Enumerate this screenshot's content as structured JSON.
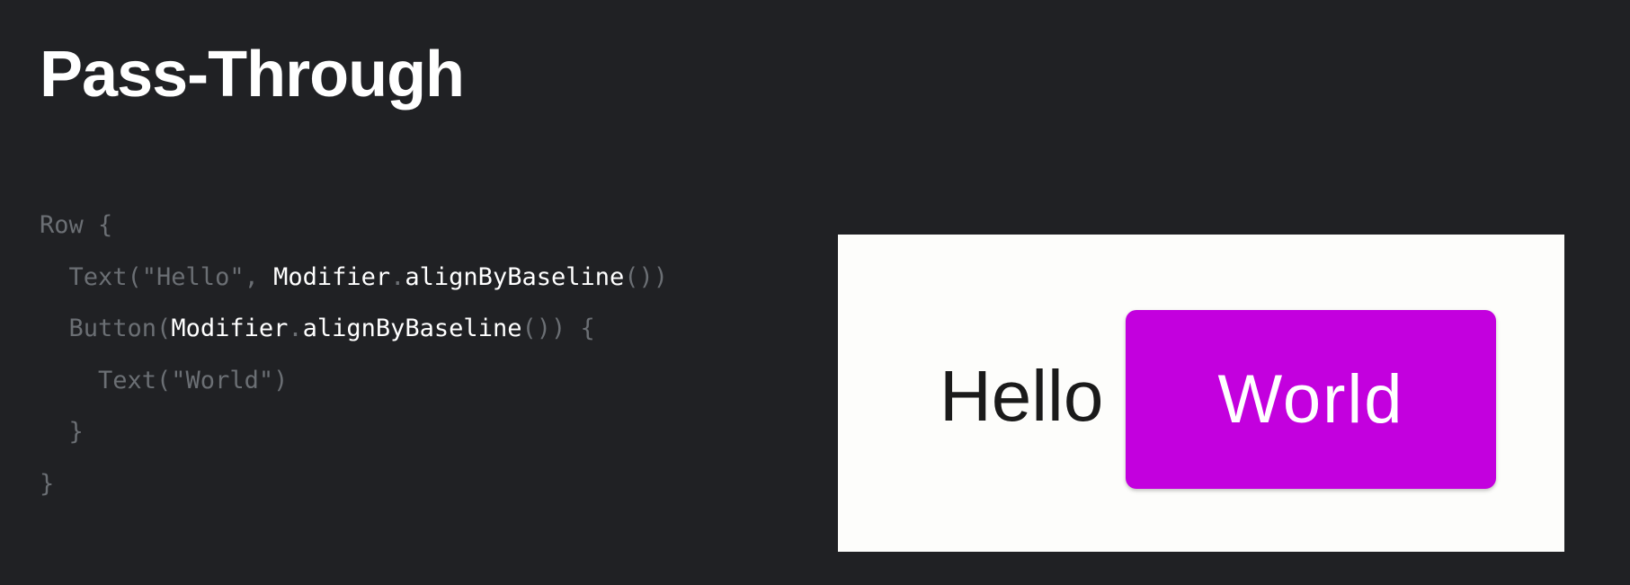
{
  "slide": {
    "title": "Pass-Through"
  },
  "code": {
    "lines": [
      [
        {
          "text": "Row {",
          "hl": false
        }
      ],
      [
        {
          "text": "  Text(\"Hello\", ",
          "hl": false
        },
        {
          "text": "Modifier",
          "hl": true
        },
        {
          "text": ".",
          "hl": false
        },
        {
          "text": "alignByBaseline",
          "hl": true
        },
        {
          "text": "())",
          "hl": false
        }
      ],
      [
        {
          "text": "  Button(",
          "hl": false
        },
        {
          "text": "Modifier",
          "hl": true
        },
        {
          "text": ".",
          "hl": false
        },
        {
          "text": "alignByBaseline",
          "hl": true
        },
        {
          "text": "()) {",
          "hl": false
        }
      ],
      [
        {
          "text": "    Text(\"World\")",
          "hl": false
        }
      ],
      [
        {
          "text": "  }",
          "hl": false
        }
      ],
      [
        {
          "text": "}",
          "hl": false
        }
      ]
    ]
  },
  "preview": {
    "hello_text": "Hello",
    "button_label": "World",
    "button_color": "#c300de",
    "background_color": "#fdfdfb"
  },
  "colors": {
    "slide_background": "#202124",
    "code_dim": "#6b6f74",
    "code_highlight": "#ffffff"
  }
}
